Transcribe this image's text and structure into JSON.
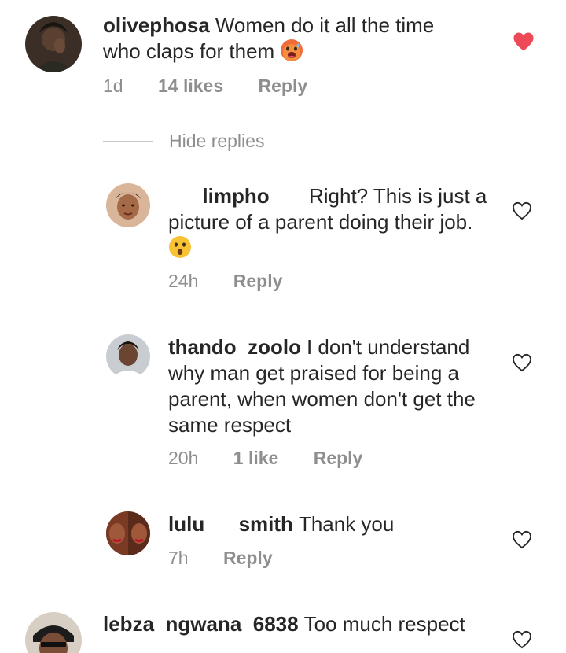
{
  "comments": [
    {
      "username": "olivephosa",
      "text": "Women do it all the time who claps for them",
      "emoji": "hot-face",
      "time": "1d",
      "likes": "14 likes",
      "reply": "Reply",
      "liked": true
    },
    {
      "username": "___limpho___",
      "text": "Right? This is just a picture of a parent doing their job.",
      "emoji": "hushed-face",
      "time": "24h",
      "likes": "",
      "reply": "Reply",
      "liked": false
    },
    {
      "username": "thando_zoolo",
      "text": "I don't understand why man get praised for being a parent, when women don't get the same respect",
      "time": "20h",
      "likes": "1 like",
      "reply": "Reply",
      "liked": false
    },
    {
      "username": "lulu___smith",
      "text": "Thank you",
      "time": "7h",
      "likes": "",
      "reply": "Reply",
      "liked": false
    },
    {
      "username": "lebza_ngwana_6838",
      "text": "Too much respect",
      "liked": false
    }
  ],
  "hide_replies": "Hide replies",
  "colors": {
    "liked_heart": "#ed4956",
    "muted": "#8e8e8e",
    "text": "#262626"
  }
}
